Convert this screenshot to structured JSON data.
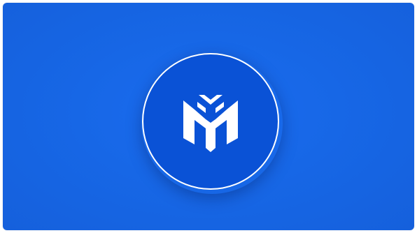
{
  "background": {
    "color": "#1767e6"
  },
  "badge": {
    "fill_color": "#0a52d6",
    "ring_color": "#ffffff"
  },
  "logo": {
    "icon": "m-monogram-logo-icon",
    "color": "#ffffff"
  }
}
